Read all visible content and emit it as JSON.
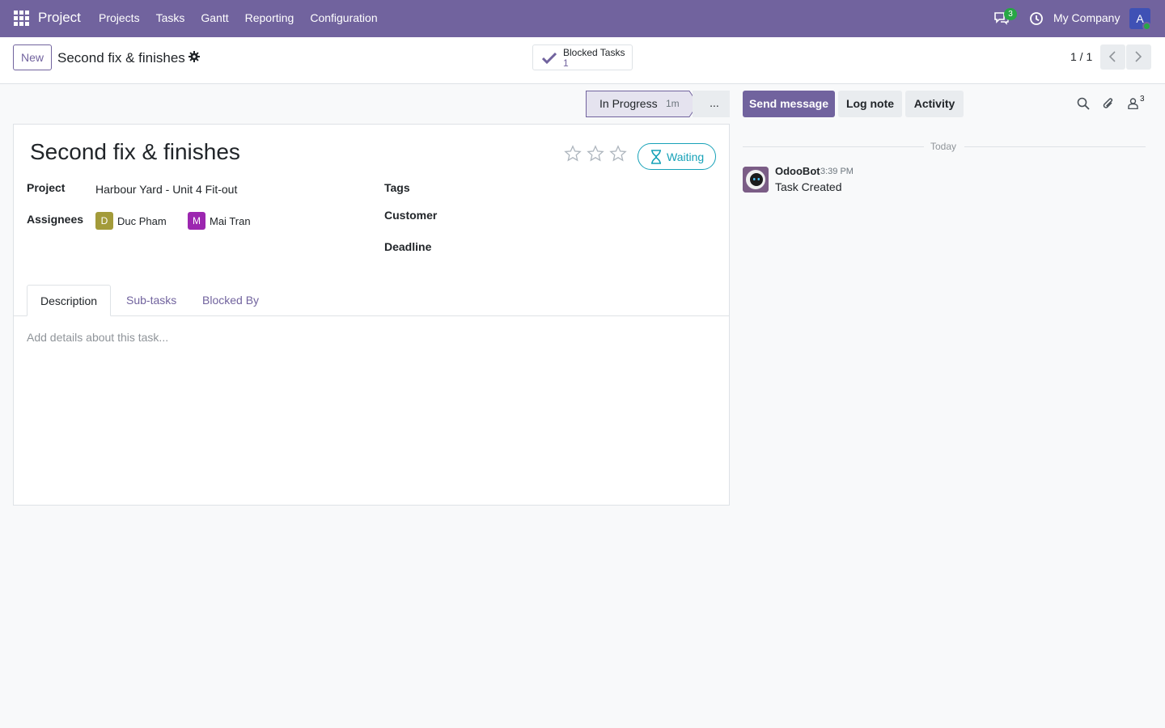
{
  "navbar": {
    "app_name": "Project",
    "menu": [
      "Projects",
      "Tasks",
      "Gantt",
      "Reporting",
      "Configuration"
    ],
    "chat_count": "3",
    "company": "My Company",
    "user_initial": "A",
    "color": "#71639e"
  },
  "control_panel": {
    "new_label": "New",
    "record_title": "Second fix & finishes",
    "blocked_tasks_label": "Blocked Tasks",
    "blocked_tasks_count": "1",
    "pager": "1 / 1"
  },
  "statusbar": {
    "current_stage": "In Progress",
    "stage_duration": "1m",
    "more_label": "..."
  },
  "form": {
    "title": "Second fix & finishes",
    "rating_stars": 3,
    "rating_value": 0,
    "state_label": "Waiting",
    "fields": {
      "project_label": "Project",
      "project_value": "Harbour Yard - Unit 4 Fit-out",
      "assignees_label": "Assignees",
      "tags_label": "Tags",
      "customer_label": "Customer",
      "deadline_label": "Deadline"
    },
    "assignees": [
      {
        "initial": "D",
        "name": "Duc Pham",
        "color": "#a39b3a"
      },
      {
        "initial": "M",
        "name": "Mai Tran",
        "color": "#9c27b0"
      }
    ],
    "tabs": [
      "Description",
      "Sub-tasks",
      "Blocked By"
    ],
    "description_placeholder": "Add details about this task..."
  },
  "chatter": {
    "send_message": "Send message",
    "log_note": "Log note",
    "activity": "Activity",
    "followers_count": "3",
    "date_separator": "Today",
    "messages": [
      {
        "author": "OdooBot",
        "time": "3:39 PM",
        "body": "Task Created"
      }
    ]
  }
}
